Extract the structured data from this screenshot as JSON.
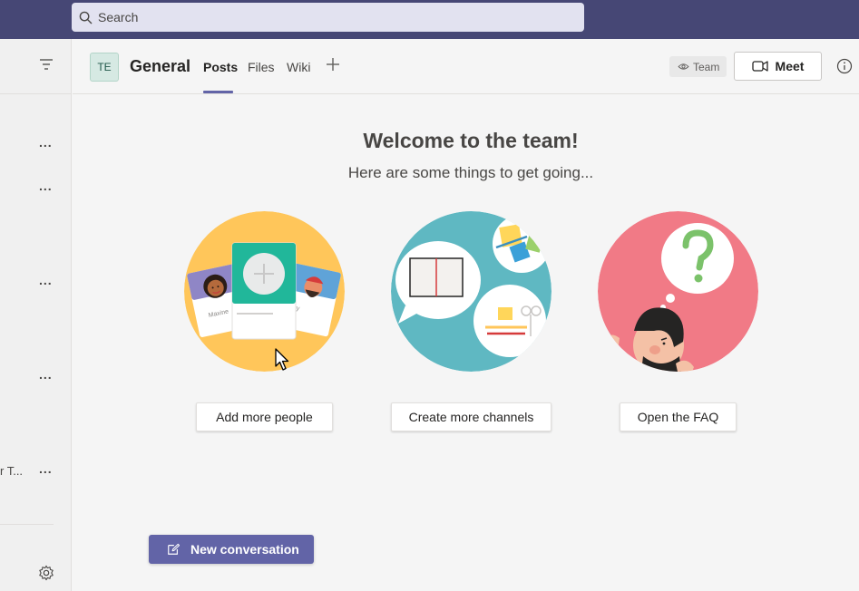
{
  "search": {
    "placeholder": "Search"
  },
  "left_panel": {
    "items": [
      {
        "more": "..."
      },
      {
        "more": "..."
      },
      {
        "more": "..."
      },
      {
        "more": "..."
      },
      {
        "label": "r T...",
        "more": "..."
      }
    ]
  },
  "channel": {
    "avatar_initials": "TE",
    "name": "General",
    "tabs": [
      "Posts",
      "Files",
      "Wiki"
    ],
    "active_tab": "Posts",
    "team_label": "Team",
    "meet_label": "Meet"
  },
  "welcome": {
    "title": "Welcome to the team!",
    "subtitle": "Here are some things to get going...",
    "card_names": [
      "Maxine",
      "ky"
    ],
    "actions": [
      "Add more people",
      "Create more channels",
      "Open the FAQ"
    ]
  },
  "compose": {
    "new_conversation_label": "New conversation"
  },
  "colors": {
    "topbar": "#464775",
    "accent": "#6264a7",
    "people_circle": "#ffc65a",
    "channels_circle": "#5fb8c2",
    "faq_circle": "#f17a86"
  },
  "icons": [
    "search-icon",
    "filter-icon",
    "more-icon",
    "gear-icon",
    "plus-icon",
    "eye-icon",
    "video-icon",
    "info-icon",
    "compose-icon",
    "mouse-cursor-icon"
  ]
}
